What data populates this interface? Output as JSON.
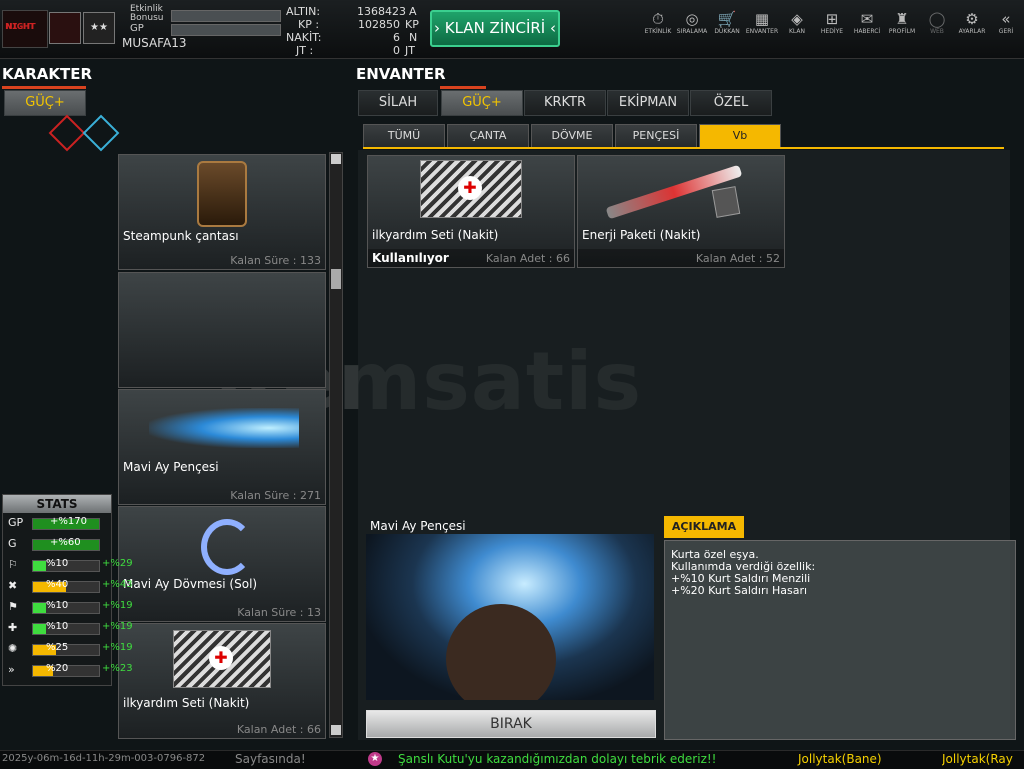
{
  "header": {
    "bonus_label": "Etkinlik Bonusu",
    "gp_label": "GP",
    "username": "MUSAFA13",
    "rank_glyph": "★★",
    "currencies": [
      {
        "label": "ALTIN:",
        "value": "1368423",
        "unit": "A"
      },
      {
        "label": "KP :",
        "value": "102850",
        "unit": "KP"
      },
      {
        "label": "NAKİT:",
        "value": "6",
        "unit": "N"
      },
      {
        "label": "JT :",
        "value": "0",
        "unit": "JT"
      }
    ],
    "clan_button": "KLAN ZİNCİRİ",
    "nav": [
      {
        "label": "ETKİNLİK",
        "icon": "⏱"
      },
      {
        "label": "SIRALAMA",
        "icon": "◎"
      },
      {
        "label": "DÜKKAN",
        "icon": "🛒"
      },
      {
        "label": "ENVANTER",
        "icon": "▦"
      },
      {
        "label": "KLAN",
        "icon": "◈"
      },
      {
        "label": "HEDİYE",
        "icon": "⊞"
      },
      {
        "label": "HABERCİ",
        "icon": "✉"
      },
      {
        "label": "PROFİLM",
        "icon": "♜"
      },
      {
        "label": "WEB",
        "icon": "◯"
      },
      {
        "label": "AYARLAR",
        "icon": "⚙"
      },
      {
        "label": "GERİ",
        "icon": "«"
      }
    ]
  },
  "left": {
    "title": "KARAKTER",
    "tab": "GÜÇ+",
    "items": [
      {
        "name": "Steampunk çantası",
        "sub": "Kalan Süre : 133"
      },
      {
        "name": "",
        "sub": ""
      },
      {
        "name": "Mavi Ay Pençesi",
        "sub": "Kalan Süre : 271"
      },
      {
        "name": "Mavi Ay Dövmesi (Sol)",
        "sub": "Kalan Süre : 13"
      },
      {
        "name": "ilkyardım Seti (Nakit)",
        "sub": "Kalan Adet : 66"
      }
    ]
  },
  "stats": {
    "title": "STATS",
    "rows": [
      {
        "icon": "GP",
        "value": "+%170",
        "bonus": "",
        "fill": 0,
        "color": "#2bb52b"
      },
      {
        "icon": "G",
        "value": "+%60",
        "bonus": "",
        "fill": 0,
        "color": "#2bb52b"
      },
      {
        "icon": "⚐",
        "value": "%10",
        "bonus": "+%29",
        "fill": 0.2,
        "color": "#3fdc3f"
      },
      {
        "icon": "✖",
        "value": "%40",
        "bonus": "+%43",
        "fill": 0.5,
        "color": "#f5b800"
      },
      {
        "icon": "⚑",
        "value": "%10",
        "bonus": "+%19",
        "fill": 0.2,
        "color": "#3fdc3f"
      },
      {
        "icon": "✚",
        "value": "%10",
        "bonus": "+%19",
        "fill": 0.2,
        "color": "#3fdc3f"
      },
      {
        "icon": "✺",
        "value": "%25",
        "bonus": "+%19",
        "fill": 0.35,
        "color": "#f5b800"
      },
      {
        "icon": "»",
        "value": "%20",
        "bonus": "+%23",
        "fill": 0.3,
        "color": "#f5b800"
      }
    ]
  },
  "inventory": {
    "title": "ENVANTER",
    "tabs": [
      "SİLAH",
      "GÜÇ+",
      "KRKTR",
      "EKİPMAN",
      "ÖZEL"
    ],
    "active_tab": 1,
    "subtabs": [
      "TÜMÜ",
      "ÇANTA",
      "DÖVME",
      "PENÇESİ",
      "Vb"
    ],
    "active_subtab": 4,
    "items": [
      {
        "name": "ilkyardım Seti (Nakit)",
        "status": "Kullanılıyor",
        "count": "Kalan Adet : 66"
      },
      {
        "name": "Enerji Paketi (Nakit)",
        "status": "",
        "count": "Kalan Adet : 52"
      }
    ]
  },
  "selected": {
    "name": "Mavi Ay Pençesi",
    "drop_button": "BIRAK",
    "desc_title": "AÇIKLAMA",
    "desc_lines": [
      "Kurta özel eşya.",
      "Kullanımda verdiği özellik:",
      "+%10 Kurt Saldırı Menzili",
      "+%20 Kurt Saldırı Hasarı"
    ]
  },
  "watermark": "itemsatis",
  "footer": {
    "left": "2025y-06m-16d-11h-29m-003-0796-872",
    "left2": "Sayfasında!",
    "message": "Şanslı Kutu'yu kazandığımızdan dolayı tebrik ederiz!!",
    "user1": "Jollytak(Bane)",
    "user2": "Jollytak(Ray"
  }
}
